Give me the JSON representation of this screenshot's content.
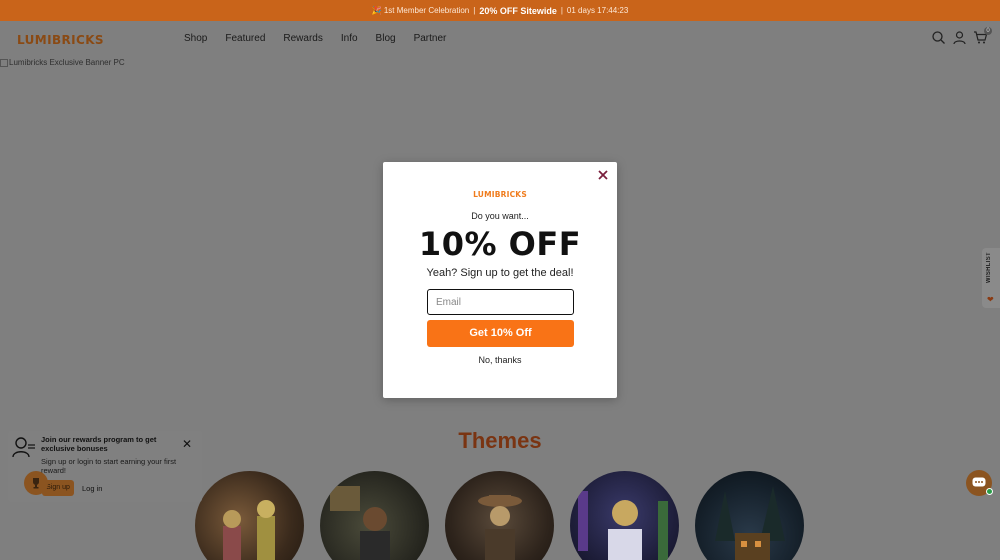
{
  "announcement": {
    "prefix": "🎉 1st Member Celebration",
    "deal": "20% OFF Sitewide",
    "countdown": "01 days 17:44:23",
    "separator": "|"
  },
  "header": {
    "logo": "LUMIBRICKS",
    "nav": [
      "Shop",
      "Featured",
      "Rewards",
      "Info",
      "Blog",
      "Partner"
    ],
    "cart_count": "0",
    "icons": [
      "search-icon",
      "account-icon",
      "cart-icon"
    ]
  },
  "banner": {
    "alt_text": "Lumibricks Exclusive Banner PC"
  },
  "themes": {
    "heading": "Themes"
  },
  "wishlist": {
    "label": "WISHLIST"
  },
  "rewards_popup": {
    "title": "Join our rewards program to get exclusive bonuses",
    "body": "Sign up or login to start earning your first reward!",
    "signup_label": "Sign up",
    "login_label": "Log in"
  },
  "modal": {
    "logo": "LUMIBRICKS",
    "eyebrow": "Do you want...",
    "headline": "10% OFF",
    "subtext": "Yeah? Sign up to get the deal!",
    "email_placeholder": "Email",
    "cta_label": "Get 10% Off",
    "decline_label": "No, thanks"
  },
  "colors": {
    "announcement_bg": "#c9641a",
    "overlay": "#7f7f7f",
    "cta": "#f97316",
    "brand_orange": "#f07c1d",
    "close_x": "#7a1f3d"
  }
}
